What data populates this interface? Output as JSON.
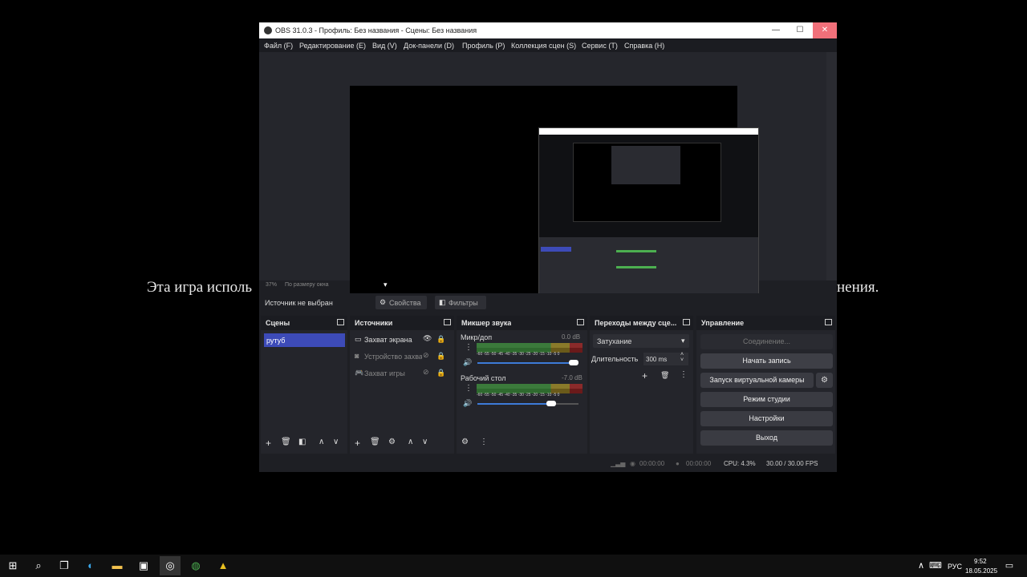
{
  "background": {
    "text_left": "Эта игра исполь",
    "text_right": "нения."
  },
  "window": {
    "title": "OBS 31.0.3 - Профиль: Без названия - Сцены: Без названия",
    "controls": {
      "minimize": "—",
      "maximize": "☐",
      "close": "✕"
    }
  },
  "menu": [
    "Файл (F)",
    "Редактирование (E)",
    "Вид (V)",
    "Док-панели (D)",
    "Профиль (P)",
    "Коллекция сцен (S)",
    "Сервис (T)",
    "Справка (H)"
  ],
  "preview": {
    "zoom": "37%",
    "scale_mode": "По размеру окна"
  },
  "source_bar": {
    "label": "Источник не выбран",
    "properties": "Свойства",
    "filters": "Фильтры"
  },
  "scenes": {
    "title": "Сцены",
    "items": [
      "рутуб"
    ]
  },
  "sources": {
    "title": "Источники",
    "items": [
      "Захват экрана",
      "Устройство захва",
      "Захват игры"
    ]
  },
  "mixer": {
    "title": "Микшер звука",
    "channels": [
      {
        "name": "Микр/доп",
        "db": "0.0 dB",
        "volume": 0.95
      },
      {
        "name": "Рабочий стол",
        "db": "-7.0 dB",
        "volume": 0.73
      }
    ],
    "scale": "-60 -55 -50 -45 -40 -35 -30 -25 -20 -15 -10 -5 0"
  },
  "transitions": {
    "title": "Переходы между сце...",
    "selected": "Затухание",
    "duration_label": "Длительность",
    "duration_value": "300 ms"
  },
  "controls": {
    "title": "Управление",
    "buttons": [
      "Соединение...",
      "Начать запись",
      "Запуск виртуальной камеры",
      "Режим студии",
      "Настройки",
      "Выход"
    ]
  },
  "status": {
    "stream_time": "00:00:00",
    "record_time": "00:00:00",
    "cpu": "CPU: 4.3%",
    "fps": "30.00 / 30.00 FPS"
  },
  "taskbar": {
    "lang": "РУС",
    "time": "9:52",
    "date": "18.05.2025"
  },
  "colors": {
    "scene_selected": "#3d4bb8",
    "accent": "#3d4bb8"
  }
}
